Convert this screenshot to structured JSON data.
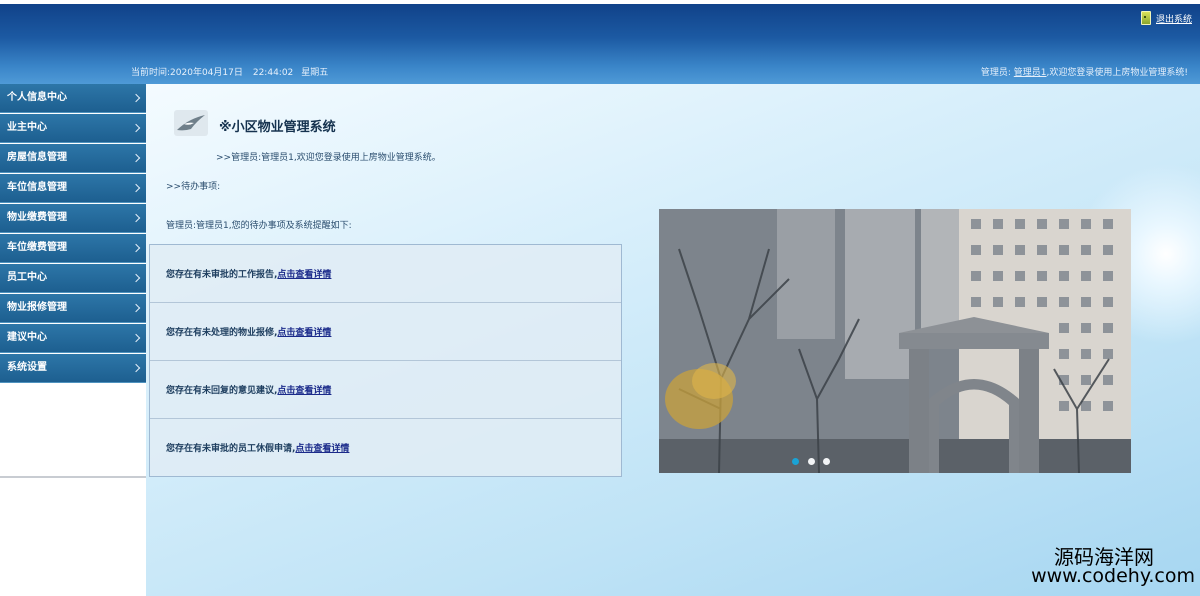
{
  "header": {
    "logout_label": "退出系统",
    "datetime_prefix": "当前时间:",
    "date": "2020年04月17日",
    "time": "22:44:02",
    "weekday": "星期五",
    "welcome_role": "管理员:",
    "welcome_user": "管理员1",
    "welcome_suffix": ",欢迎您登录使用上房物业管理系统!"
  },
  "sidebar": {
    "items": [
      {
        "label": "个人信息中心"
      },
      {
        "label": "业主中心"
      },
      {
        "label": "房屋信息管理"
      },
      {
        "label": "车位信息管理"
      },
      {
        "label": "物业缴费管理"
      },
      {
        "label": "车位缴费管理"
      },
      {
        "label": "员工中心"
      },
      {
        "label": "物业报修管理"
      },
      {
        "label": "建议中心"
      },
      {
        "label": "系统设置"
      }
    ]
  },
  "main": {
    "title": "※小区物业管理系统",
    "greeting": ">>管理员:管理员1,欢迎您登录使用上房物业管理系统。",
    "todo_label": ">>待办事项:",
    "todo_intro": "管理员:管理员1,您的待办事项及系统提醒如下:",
    "todos": [
      {
        "text": "您存在有未审批的工作报告,",
        "link": "点击查看详情"
      },
      {
        "text": "您存在有未处理的物业报修,",
        "link": "点击查看详情"
      },
      {
        "text": "您存在有未回复的意见建议,",
        "link": "点击查看详情"
      },
      {
        "text": "您存在有未审批的员工休假申请,",
        "link": "点击查看详情"
      }
    ],
    "carousel": {
      "slide_count": 3,
      "active_index": 0,
      "active_color": "#1aa3d6",
      "inactive_color": "#f2f4f6"
    }
  },
  "watermark": {
    "cn": "源码海洋网",
    "url": "www.codehy.com"
  },
  "colors": {
    "header_dark": "#0f3f86",
    "header_light": "#4f9ad7",
    "sidebar_item": "#1d5f90",
    "link": "#1a2a8a"
  }
}
